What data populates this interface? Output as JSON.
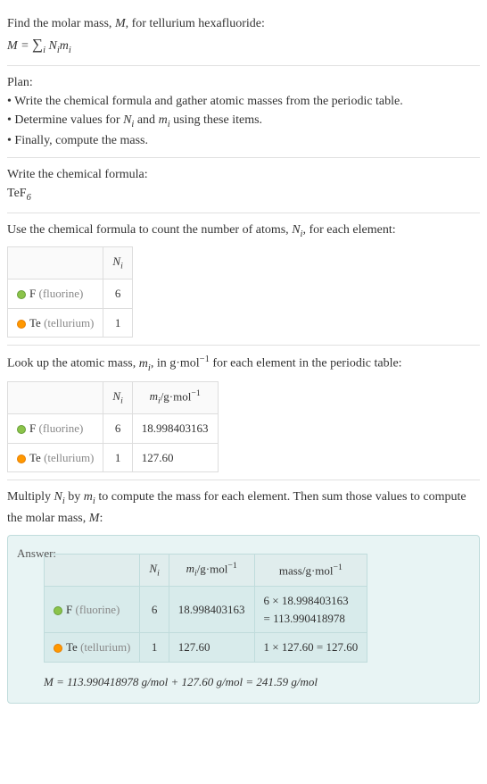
{
  "intro": {
    "heading": "Find the molar mass, M, for tellurium hexafluoride:",
    "formula": "M = ∑",
    "formula_sub": "i",
    "formula_rhs": "Nᵢmᵢ"
  },
  "plan": {
    "heading": "Plan:",
    "b1": "• Write the chemical formula and gather atomic masses from the periodic table.",
    "b2": "• Determine values for Nᵢ and mᵢ using these items.",
    "b3": "• Finally, compute the mass."
  },
  "write_formula": {
    "heading": "Write the chemical formula:",
    "formula": "TeF",
    "sub": "6"
  },
  "count_atoms": {
    "heading": "Use the chemical formula to count the number of atoms, Nᵢ, for each element:",
    "col_n": "Nᵢ",
    "row1_sym": "F",
    "row1_name": "(fluorine)",
    "row1_n": "6",
    "row2_sym": "Te",
    "row2_name": "(tellurium)",
    "row2_n": "1"
  },
  "lookup": {
    "heading_pre": "Look up the atomic mass, mᵢ, in g·mol",
    "heading_sup": "−1",
    "heading_post": " for each element in the periodic table:",
    "col_n": "Nᵢ",
    "col_m_pre": "mᵢ/g·mol",
    "col_m_sup": "−1",
    "row1_sym": "F",
    "row1_name": "(fluorine)",
    "row1_n": "6",
    "row1_m": "18.998403163",
    "row2_sym": "Te",
    "row2_name": "(tellurium)",
    "row2_n": "1",
    "row2_m": "127.60"
  },
  "multiply": {
    "heading": "Multiply Nᵢ by mᵢ to compute the mass for each element. Then sum those values to compute the molar mass, M:"
  },
  "answer": {
    "label": "Answer:",
    "col_n": "Nᵢ",
    "col_m_pre": "mᵢ/g·mol",
    "col_m_sup": "−1",
    "col_mass_pre": "mass/g·mol",
    "col_mass_sup": "−1",
    "row1_sym": "F",
    "row1_name": "(fluorine)",
    "row1_n": "6",
    "row1_m": "18.998403163",
    "row1_mass_line1": "6 × 18.998403163",
    "row1_mass_line2": "= 113.990418978",
    "row2_sym": "Te",
    "row2_name": "(tellurium)",
    "row2_n": "1",
    "row2_m": "127.60",
    "row2_mass": "1 × 127.60 = 127.60",
    "final": "M = 113.990418978 g/mol + 127.60 g/mol = 241.59 g/mol"
  },
  "chart_data": {
    "type": "table",
    "title": "Molar mass of tellurium hexafluoride (TeF6)",
    "elements": [
      {
        "symbol": "F",
        "name": "fluorine",
        "N": 6,
        "atomic_mass_g_per_mol": 18.998403163,
        "mass_g_per_mol": 113.990418978
      },
      {
        "symbol": "Te",
        "name": "tellurium",
        "N": 1,
        "atomic_mass_g_per_mol": 127.6,
        "mass_g_per_mol": 127.6
      }
    ],
    "molar_mass_g_per_mol": 241.59
  }
}
